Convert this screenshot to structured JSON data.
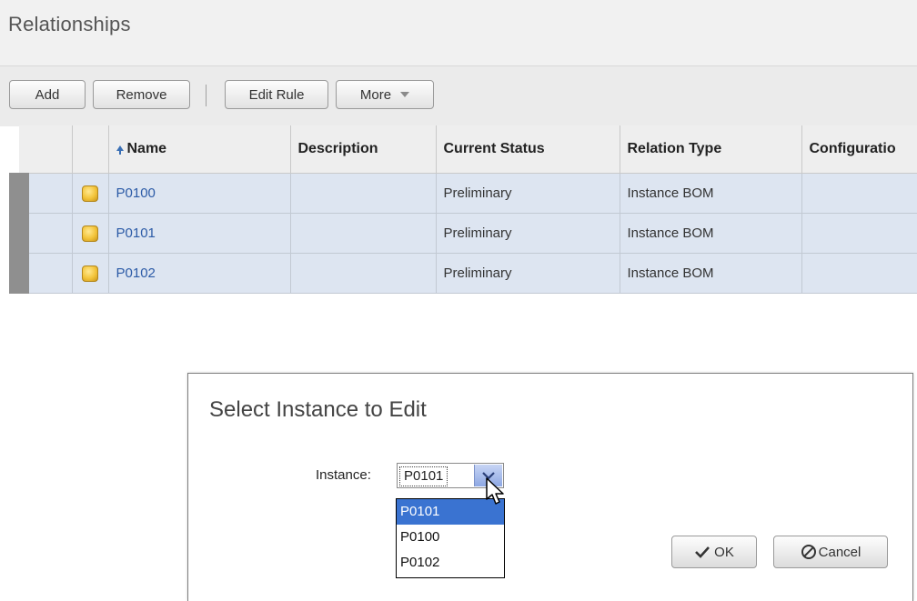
{
  "page": {
    "title": "Relationships"
  },
  "toolbar": {
    "add_label": "Add",
    "remove_label": "Remove",
    "edit_rule_label": "Edit Rule",
    "more_label": "More"
  },
  "grid": {
    "columns": [
      "Name",
      "Description",
      "Current Status",
      "Relation Type",
      "Configuratio"
    ],
    "sort_column": "Name",
    "sort_direction": "ascending",
    "rows": [
      {
        "name": "P0100",
        "description": "",
        "status": "Preliminary",
        "relation_type": "Instance BOM",
        "configuration": ""
      },
      {
        "name": "P0101",
        "description": "",
        "status": "Preliminary",
        "relation_type": "Instance BOM",
        "configuration": ""
      },
      {
        "name": "P0102",
        "description": "",
        "status": "Preliminary",
        "relation_type": "Instance BOM",
        "configuration": ""
      }
    ]
  },
  "dialog": {
    "title": "Select Instance to Edit",
    "instance_label": "Instance:",
    "instance_value": "P0101",
    "options": [
      "P0101",
      "P0100",
      "P0102"
    ],
    "highlighted_option": "P0101",
    "ok_label": "OK",
    "cancel_label": "Cancel"
  },
  "icons": {
    "row_icon": "part-cube-icon",
    "sort_icon": "sort-ascending-icon",
    "ok_icon": "checkmark-icon",
    "cancel_icon": "cancel-circle-icon",
    "dropdown_icon": "chevron-down-icon",
    "cursor": "mouse-pointer-icon"
  },
  "colors": {
    "row_background": "#dde5f1",
    "link": "#2c5ba7",
    "selected_option": "#3a73d1"
  }
}
